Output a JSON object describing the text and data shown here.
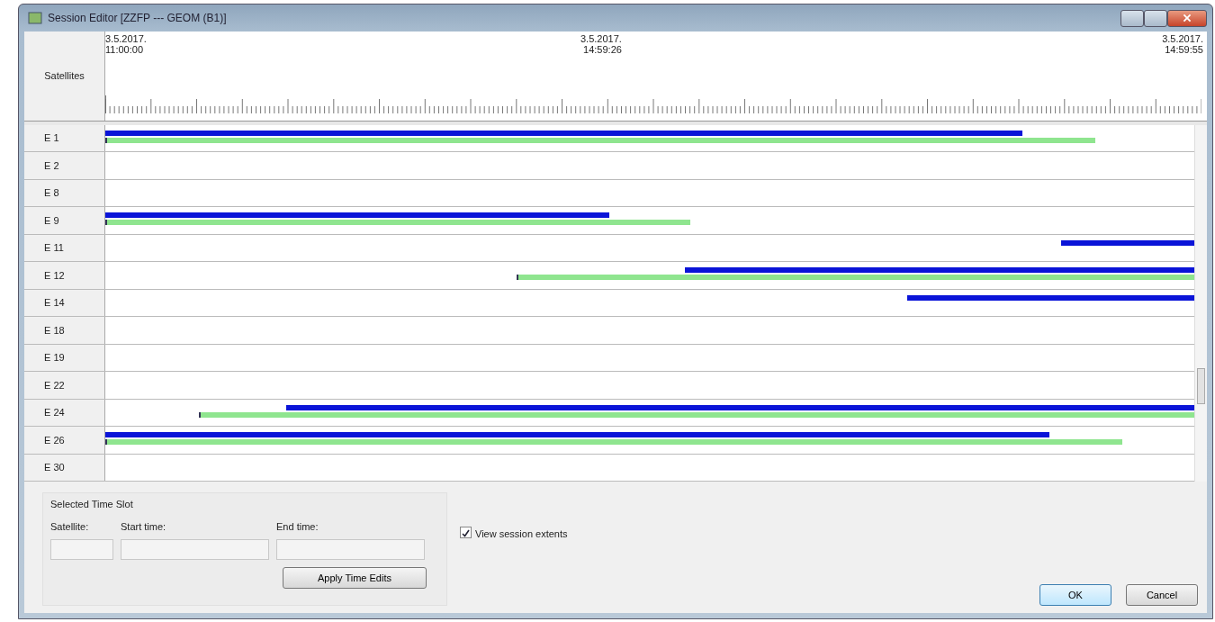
{
  "window": {
    "title": "Session Editor [ZZFP --- GEOM (B1)]"
  },
  "timeline": {
    "row_header": "Satellites",
    "time_labels": [
      {
        "date": "3.5.2017.",
        "time": "11:00:00"
      },
      {
        "date": "3.5.2017.",
        "time": "14:59:26"
      },
      {
        "date": "3.5.2017.",
        "time": "14:59:55"
      }
    ]
  },
  "satellites": [
    {
      "name": "E 1"
    },
    {
      "name": "E 2"
    },
    {
      "name": "E 8"
    },
    {
      "name": "E 9"
    },
    {
      "name": "E 11"
    },
    {
      "name": "E 12"
    },
    {
      "name": "E 14"
    },
    {
      "name": "E 18"
    },
    {
      "name": "E 19"
    },
    {
      "name": "E 22"
    },
    {
      "name": "E 24"
    },
    {
      "name": "E 26"
    },
    {
      "name": "E 30"
    }
  ],
  "selected_time_slot": {
    "title": "Selected Time Slot",
    "fields": [
      {
        "label": "Satellite:"
      },
      {
        "label": "Start time:"
      },
      {
        "label": "End time:"
      }
    ],
    "apply_button": "Apply Time Edits"
  },
  "view_session_extents": {
    "label": "View session extents",
    "checked": true
  },
  "buttons": [
    "OK",
    "Cancel"
  ]
}
